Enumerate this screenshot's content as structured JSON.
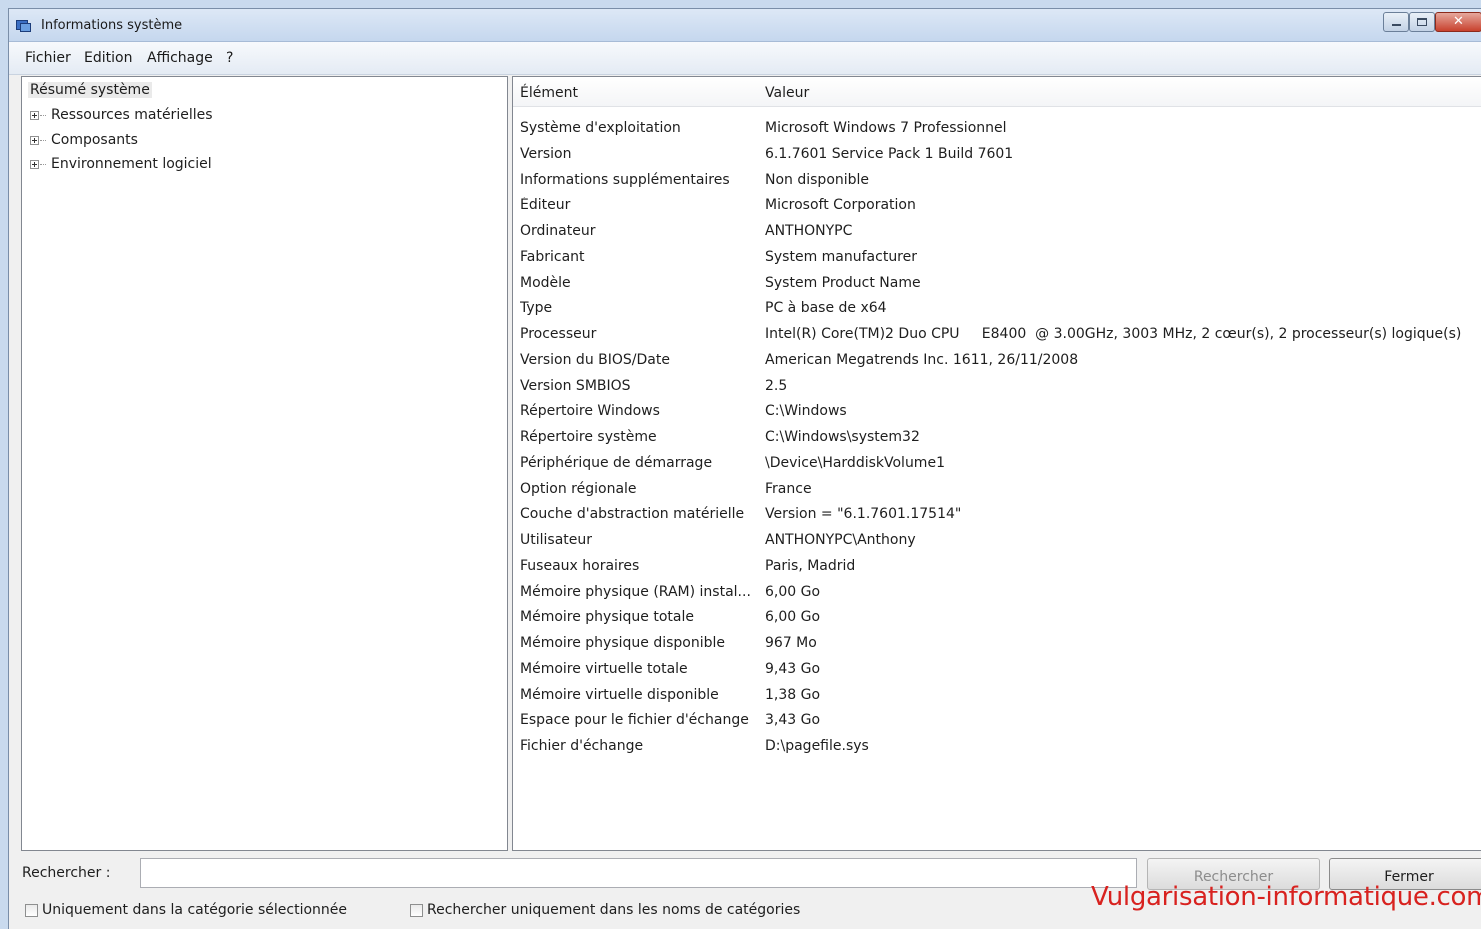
{
  "window": {
    "title": "Informations système",
    "close_glyph": "✕"
  },
  "menu": [
    "Fichier",
    "Edition",
    "Affichage",
    "?"
  ],
  "tree": {
    "root": "Résumé système",
    "nodes": [
      "Ressources matérielles",
      "Composants",
      "Environnement logiciel"
    ]
  },
  "table": {
    "headers": [
      "Élément",
      "Valeur"
    ],
    "rows": [
      [
        "Système d'exploitation",
        "Microsoft Windows 7 Professionnel"
      ],
      [
        "Version",
        "6.1.7601 Service Pack 1 Build 7601"
      ],
      [
        "Informations supplémentaires",
        "Non disponible"
      ],
      [
        "Éditeur",
        "Microsoft Corporation"
      ],
      [
        "Ordinateur",
        "ANTHONYPC"
      ],
      [
        "Fabricant",
        "System manufacturer"
      ],
      [
        "Modèle",
        "System Product Name"
      ],
      [
        "Type",
        "PC à base de x64"
      ],
      [
        "Processeur",
        "Intel(R) Core(TM)2 Duo CPU     E8400  @ 3.00GHz, 3003 MHz, 2 cœur(s), 2 processeur(s) logique(s)"
      ],
      [
        "Version du BIOS/Date",
        "American Megatrends Inc. 1611, 26/11/2008"
      ],
      [
        "Version SMBIOS",
        "2.5"
      ],
      [
        "Répertoire Windows",
        "C:\\Windows"
      ],
      [
        "Répertoire système",
        "C:\\Windows\\system32"
      ],
      [
        "Périphérique de démarrage",
        "\\Device\\HarddiskVolume1"
      ],
      [
        "Option régionale",
        "France"
      ],
      [
        "Couche d'abstraction matérielle",
        "Version = \"6.1.7601.17514\""
      ],
      [
        "Utilisateur",
        "ANTHONYPC\\Anthony"
      ],
      [
        "Fuseaux horaires",
        "Paris, Madrid"
      ],
      [
        "Mémoire physique (RAM) instal...",
        "6,00 Go"
      ],
      [
        "Mémoire physique totale",
        "6,00 Go"
      ],
      [
        "Mémoire physique disponible",
        "967 Mo"
      ],
      [
        "Mémoire virtuelle totale",
        "9,43 Go"
      ],
      [
        "Mémoire virtuelle disponible",
        "1,38 Go"
      ],
      [
        "Espace pour le fichier d'échange",
        "3,43 Go"
      ],
      [
        "Fichier d'échange",
        "D:\\pagefile.sys"
      ]
    ]
  },
  "search": {
    "label": "Rechercher :",
    "value": "",
    "search_button": "Rechercher",
    "close_button": "Fermer",
    "option_category": "Uniquement dans la catégorie sélectionnée",
    "option_names": "Rechercher uniquement dans les noms de catégories"
  },
  "watermark": "Vulgarisation-informatique.com",
  "colors": {
    "watermark": "#d8221f",
    "titlebar": "#c5d7ee",
    "close_button": "#c8412d"
  }
}
